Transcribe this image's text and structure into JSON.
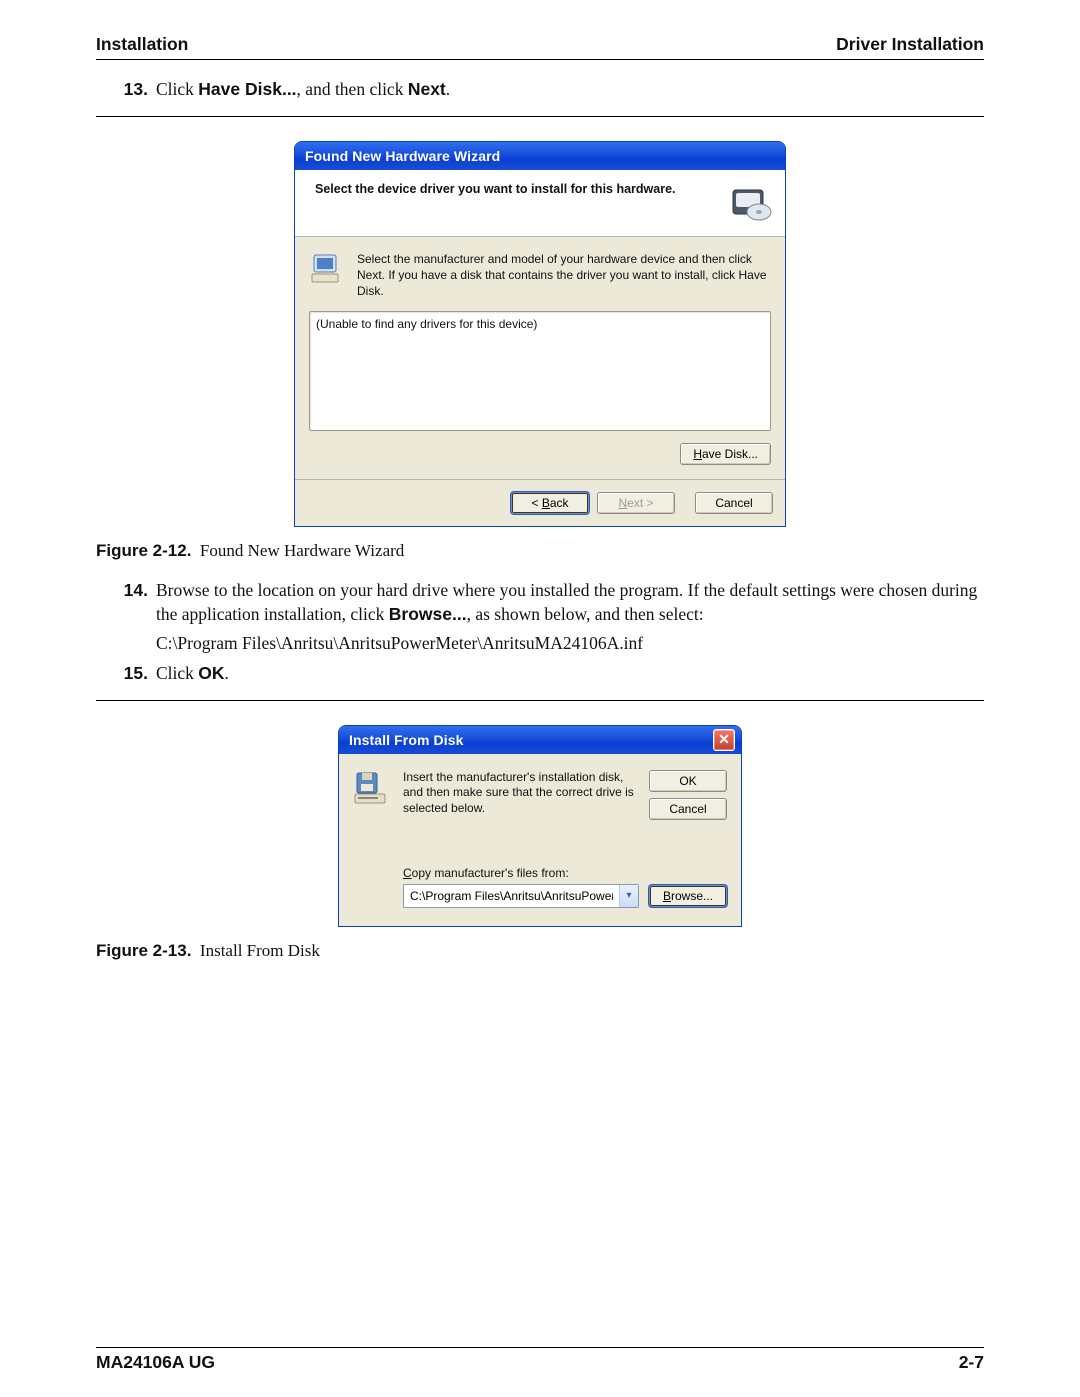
{
  "header": {
    "left": "Installation",
    "right": "Driver Installation"
  },
  "steps": {
    "s13": {
      "num": "13.",
      "prefix": "Click ",
      "bold1": "Have Disk...",
      "mid": ", and then click ",
      "bold2": "Next",
      "suffix": "."
    },
    "s14": {
      "num": "14.",
      "text_a": "Browse to the location on your hard drive where you installed the program. If the default settings were chosen during the application installation, click ",
      "bold": "Browse...",
      "text_b": ", as shown below, and then select:"
    },
    "s14_path": "C:\\Program Files\\Anritsu\\AnritsuPowerMeter\\AnritsuMA24106A.inf",
    "s15": {
      "num": "15.",
      "prefix": "Click ",
      "bold": "OK",
      "suffix": "."
    }
  },
  "fig12": {
    "title": "Found New Hardware Wizard",
    "head": "Select the device driver you want to install for this hardware.",
    "desc": "Select the manufacturer and model of your hardware device and then click Next. If you have a disk that contains the driver you want to install, click Have Disk.",
    "list": "(Unable to find any drivers for this device)",
    "have_disk_pre": "H",
    "have_disk_post": "ave Disk...",
    "back_pre": "< ",
    "back_u": "B",
    "back_post": "ack",
    "next_u": "N",
    "next_post": "ext >",
    "cancel": "Cancel",
    "caption_lead": "Figure 2-12.",
    "caption_rest": "Found New Hardware Wizard"
  },
  "fig13": {
    "title": "Install From Disk",
    "msg": "Insert the manufacturer's installation disk, and then make sure that the correct drive is selected below.",
    "ok": "OK",
    "cancel": "Cancel",
    "label_u": "C",
    "label_rest": "opy manufacturer's files from:",
    "path": "C:\\Program Files\\Anritsu\\AnritsuPowerMeter",
    "browse_u": "B",
    "browse_post": "rowse...",
    "caption_lead": "Figure 2-13.",
    "caption_rest": "Install From Disk"
  },
  "footer": {
    "left": "MA24106A UG",
    "right": "2-7"
  }
}
